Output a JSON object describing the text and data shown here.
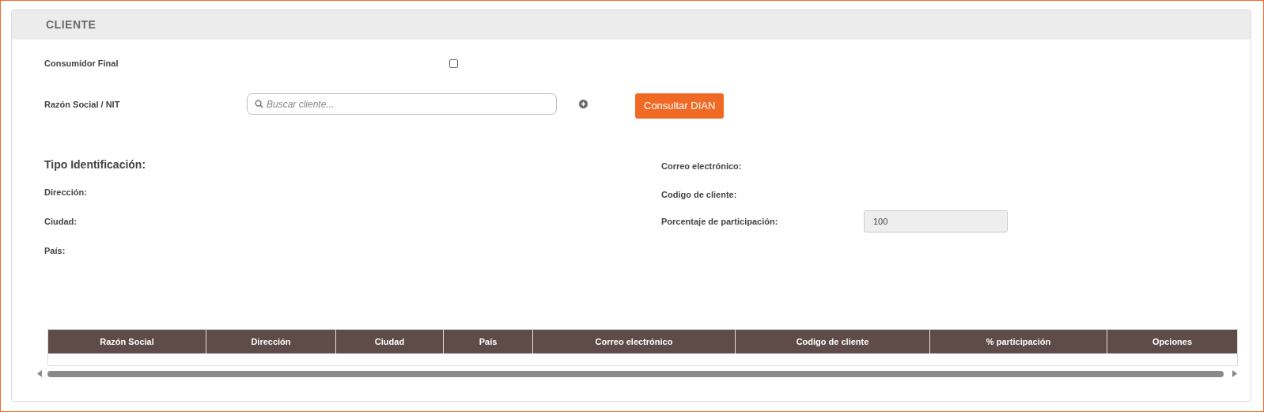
{
  "section": {
    "title": "CLIENTE"
  },
  "consumidor_final": {
    "label": "Consumidor Final",
    "checked": false
  },
  "razon_social": {
    "label": "Razón Social / NIT",
    "placeholder": "Buscar cliente..."
  },
  "consultar_button": "Consultar DIAN",
  "left_fields": [
    {
      "label": "Tipo Identificación:",
      "kind": "heading"
    },
    {
      "label": "Dirección:",
      "kind": "plain"
    },
    {
      "label": "Ciudad:",
      "kind": "plain"
    },
    {
      "label": "País:",
      "kind": "plain"
    }
  ],
  "right_fields": [
    {
      "label": "Correo electrónico:",
      "kind": "plain"
    },
    {
      "label": "Codigo de cliente:",
      "kind": "plain"
    },
    {
      "label": "Porcentaje de participación:",
      "kind": "input",
      "value": "100",
      "disabled": true
    }
  ],
  "table": {
    "columns": [
      "Razón Social",
      "Dirección",
      "Ciudad",
      "País",
      "Correo electrónico",
      "Codigo de cliente",
      "% participación",
      "Opciones"
    ]
  }
}
